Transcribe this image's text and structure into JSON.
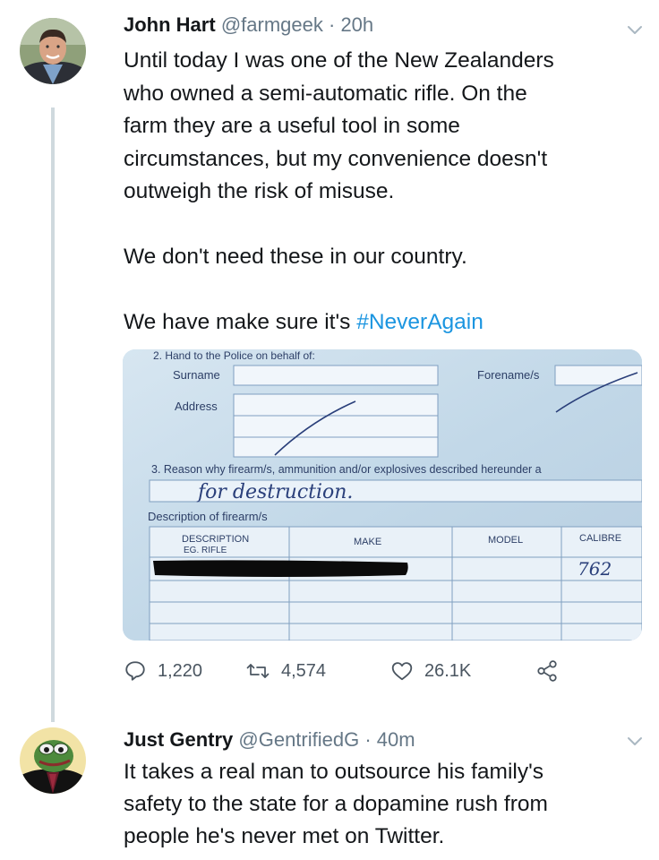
{
  "tweet1": {
    "name": "John Hart",
    "handle": "@farmgeek",
    "dot": "·",
    "time": "20h",
    "lines": [
      "Until today I was one of the New Zealanders",
      "who owned a semi-automatic rifle. On the",
      "farm they are a useful tool in some",
      "circumstances, but my convenience doesn't",
      "outweigh the risk of misuse."
    ],
    "para2": "We don't need these in our country.",
    "para3_prefix": "We have make sure it's ",
    "hashtag": "#NeverAgain",
    "stats": {
      "replies": "1,220",
      "retweets": "4,574",
      "likes": "26.1K"
    },
    "form": {
      "section2": "2.  Hand to the Police on behalf of:",
      "surname": "Surname",
      "forename": "Forename/s",
      "address": "Address",
      "section3": "3.  Reason why firearm/s, ammunition and/or explosives described hereunder a",
      "handwriting_reason": "for destruction.",
      "description_label": "Description of firearm/s",
      "col_description": "DESCRIPTION",
      "col_description_sub": "EG. RIFLE",
      "col_make": "MAKE",
      "col_model": "MODEL",
      "col_calibre": "CALIBRE",
      "handwriting_calibre": "762"
    }
  },
  "tweet2": {
    "name": "Just Gentry",
    "handle": "@GentrifiedG",
    "dot": "·",
    "time": "40m",
    "lines": [
      "It takes a real man to outsource his family's",
      "safety to the state for a dopamine rush from",
      "people he's never met on Twitter."
    ]
  },
  "colors": {
    "hashtag": "#1b95e0",
    "muted": "#657786",
    "thread_line": "#cfd9de"
  },
  "icons": [
    "reply-icon",
    "retweet-icon",
    "like-icon",
    "share-icon",
    "chevron-down-icon"
  ]
}
